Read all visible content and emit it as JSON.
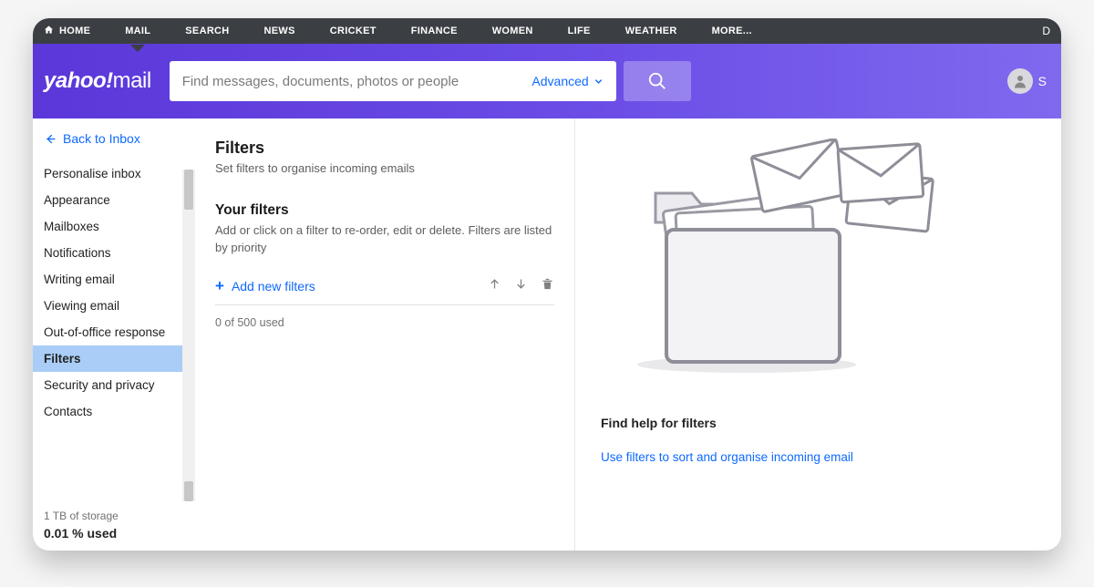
{
  "topnav": {
    "items": [
      "HOME",
      "MAIL",
      "SEARCH",
      "NEWS",
      "CRICKET",
      "FINANCE",
      "WOMEN",
      "LIFE",
      "WEATHER",
      "MORE..."
    ],
    "right": "D"
  },
  "logo": {
    "brand": "yahoo!",
    "product": "mail"
  },
  "search": {
    "placeholder": "Find messages, documents, photos or people",
    "advanced": "Advanced"
  },
  "account": {
    "initial": "S"
  },
  "sidebar": {
    "back": "Back to Inbox",
    "items": [
      {
        "label": "Personalise inbox"
      },
      {
        "label": "Appearance"
      },
      {
        "label": "Mailboxes"
      },
      {
        "label": "Notifications"
      },
      {
        "label": "Writing email"
      },
      {
        "label": "Viewing email"
      },
      {
        "label": "Out-of-office response"
      },
      {
        "label": "Filters",
        "active": true
      },
      {
        "label": "Security and privacy"
      },
      {
        "label": "Contacts"
      }
    ],
    "storage": {
      "label": "1 TB of storage",
      "used": "0.01 % used"
    }
  },
  "main": {
    "title": "Filters",
    "subtitle": "Set filters to organise incoming emails",
    "section_title": "Your filters",
    "section_sub": "Add or click on a filter to re-order, edit or delete. Filters are listed by priority",
    "add_label": "Add new filters",
    "used_count": "0 of 500 used"
  },
  "help": {
    "title": "Find help for filters",
    "link": "Use filters to sort and organise incoming email"
  }
}
